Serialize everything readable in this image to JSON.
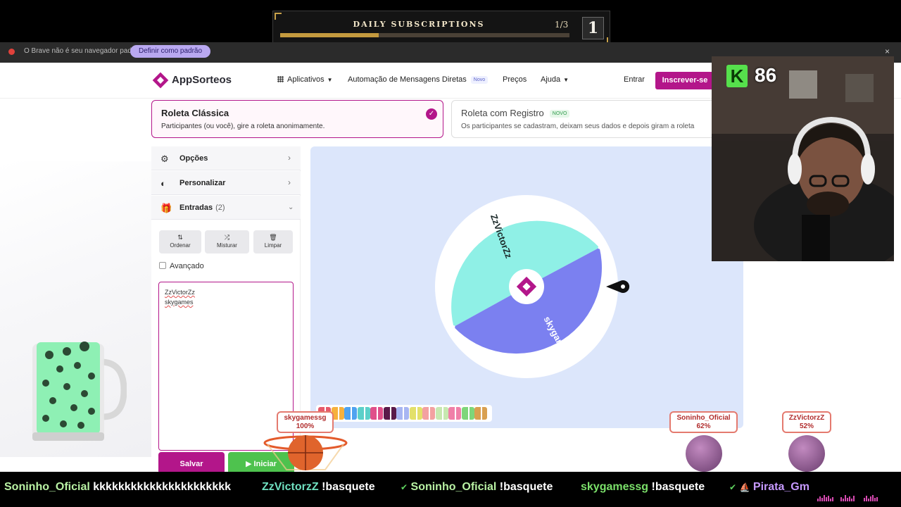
{
  "subscriptions": {
    "title": "DAILY SUBSCRIPTIONS",
    "count": "1/3",
    "badge": "1",
    "progress": 0.34
  },
  "browser_notice": {
    "text": "O Brave não é seu navegador padrão",
    "button": "Definir como padrão",
    "close": "×"
  },
  "site": {
    "logo": "AppSorteos",
    "nav": {
      "apps": "Aplicativos",
      "automation": "Automação de Mensagens Diretas",
      "automation_badge": "Novo",
      "prices": "Preços",
      "help": "Ajuda"
    },
    "login": "Entrar",
    "signup": "Inscrever-se",
    "modes": [
      {
        "title": "Roleta Clássica",
        "desc": "Participantes (ou você), gire a roleta anonimamente."
      },
      {
        "title": "Roleta com Registro",
        "badge": "NOVO",
        "desc": "Os participantes se cadastram, deixam seus dados e depois giram a roleta"
      }
    ],
    "panel": {
      "options": "Opções",
      "customize": "Personalizar",
      "entries": "Entradas",
      "entries_count": "(2)",
      "tools": {
        "sort": "Ordenar",
        "shuffle": "Misturar",
        "clear": "Limpar"
      },
      "advanced": "Avançado",
      "entries_list": [
        "ZzVictorZz",
        "skygames"
      ]
    },
    "save": "Salvar",
    "start": "▶ Iniciar",
    "wheel": {
      "segments": [
        "ZzVictorZz",
        "skygames"
      ],
      "colors": [
        "#8ff0e6",
        "#7b80f0"
      ]
    },
    "swatch_colors": [
      "#e75a6a",
      "#f6b13c",
      "#4fa3f0",
      "#5bd0c9",
      "#e04f8a",
      "#5a1a4a",
      "#a8b6f2",
      "#e3e06a",
      "#f3a1a1",
      "#c7e8b0",
      "#f07fa8",
      "#7ed67a",
      "#d9a050"
    ]
  },
  "stream": {
    "points": "86",
    "tags": [
      {
        "name": "skygamessg",
        "pct": "100%"
      },
      {
        "name": "Soninho_Oficial",
        "pct": "62%"
      },
      {
        "name": "ZzVictorzZ",
        "pct": "52%"
      }
    ],
    "ticker": [
      {
        "user": "Soninho_Oficial",
        "msg": "kkkkkkkkkkkkkkkkkkkkkk",
        "color": "#b9f2a4"
      },
      {
        "user": "ZzVictorzZ",
        "msg": "!basquete",
        "color": "#6fe0c0"
      },
      {
        "user": "Soninho_Oficial",
        "msg": "!basquete",
        "color": "#b9f2a4"
      },
      {
        "user": "skygamessg",
        "msg": "!basquete",
        "color": "#7be06a"
      },
      {
        "user": "Pirata_Gm",
        "msg": "",
        "color": "#c79aff"
      }
    ]
  }
}
